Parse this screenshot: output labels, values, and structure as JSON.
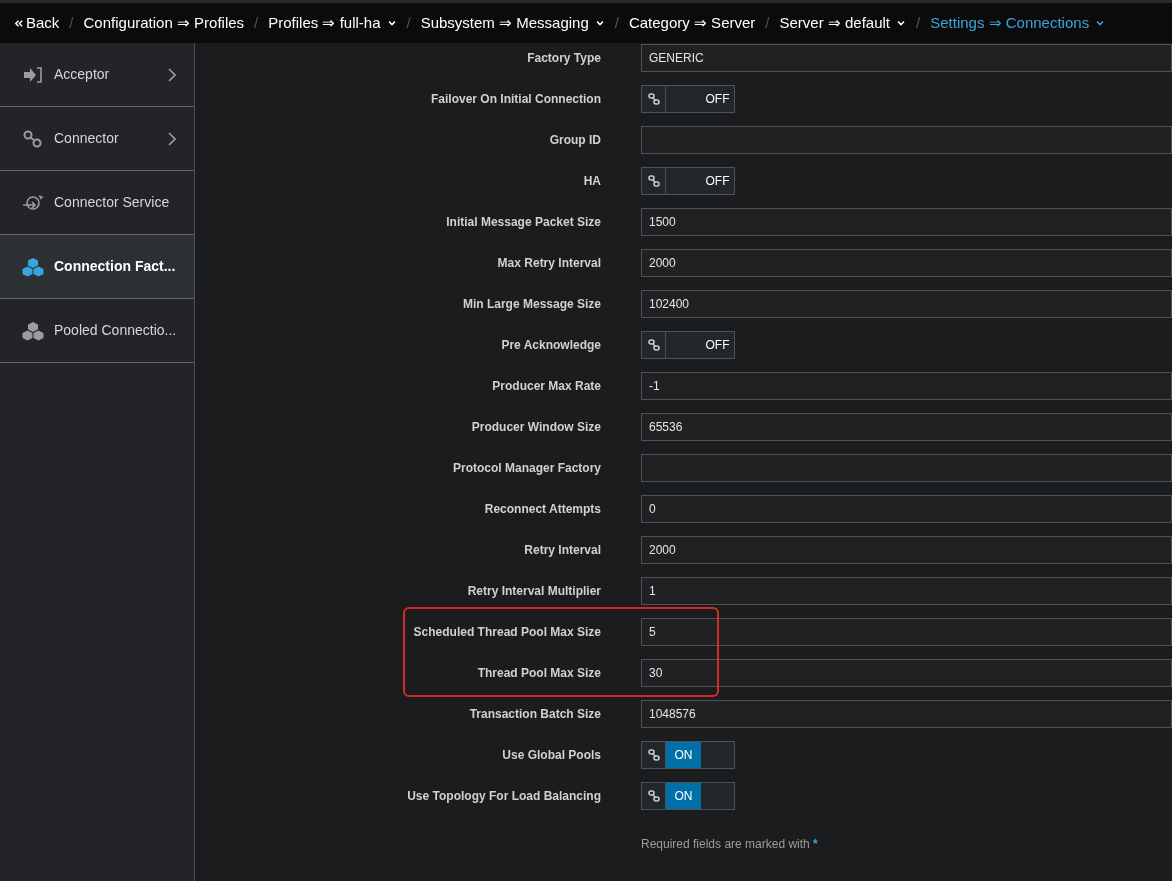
{
  "breadcrumb": {
    "back": "Back",
    "separator": "/",
    "items": [
      {
        "text": "Configuration ⇒ Profiles",
        "dropdown": false,
        "selected": false
      },
      {
        "text": "Profiles ⇒ full-ha",
        "dropdown": true,
        "selected": false
      },
      {
        "text": "Subsystem ⇒ Messaging",
        "dropdown": true,
        "selected": false
      },
      {
        "text": "Category ⇒ Server",
        "dropdown": false,
        "selected": false
      },
      {
        "text": "Server ⇒ default",
        "dropdown": true,
        "selected": false
      },
      {
        "text": "Settings ⇒ Connections",
        "dropdown": true,
        "selected": true
      }
    ]
  },
  "sidebar": {
    "items": [
      {
        "label": "Acceptor",
        "kind": "acceptor",
        "chevron": true,
        "selected": false
      },
      {
        "label": "Connector",
        "kind": "connector",
        "chevron": true,
        "selected": false
      },
      {
        "label": "Connector Service",
        "kind": "service",
        "chevron": false,
        "selected": false
      },
      {
        "label": "Connection Fact...",
        "kind": "cubes",
        "chevron": false,
        "selected": true
      },
      {
        "label": "Pooled Connectio...",
        "kind": "cubes",
        "chevron": false,
        "selected": false
      }
    ]
  },
  "form": {
    "fields": [
      {
        "label": "Factory Type",
        "kind": "text",
        "value": "GENERIC",
        "highlighted": false
      },
      {
        "label": "Failover On Initial Connection",
        "kind": "toggle",
        "on": false,
        "state_text": "OFF",
        "highlighted": false
      },
      {
        "label": "Group ID",
        "kind": "text",
        "highlighted": false
      },
      {
        "label": "HA",
        "kind": "toggle",
        "on": false,
        "state_text": "OFF",
        "highlighted": false
      },
      {
        "label": "Initial Message Packet Size",
        "kind": "text",
        "value": "1500",
        "highlighted": false
      },
      {
        "label": "Max Retry Interval",
        "kind": "text",
        "value": "2000",
        "highlighted": false
      },
      {
        "label": "Min Large Message Size",
        "kind": "text",
        "value": "102400",
        "highlighted": false
      },
      {
        "label": "Pre Acknowledge",
        "kind": "toggle",
        "on": false,
        "state_text": "OFF",
        "highlighted": false
      },
      {
        "label": "Producer Max Rate",
        "kind": "text",
        "value": "-1",
        "highlighted": false
      },
      {
        "label": "Producer Window Size",
        "kind": "text",
        "value": "65536",
        "highlighted": false
      },
      {
        "label": "Protocol Manager Factory",
        "kind": "text",
        "highlighted": false
      },
      {
        "label": "Reconnect Attempts",
        "kind": "text",
        "value": "0",
        "highlighted": false
      },
      {
        "label": "Retry Interval",
        "kind": "text",
        "value": "2000",
        "highlighted": false
      },
      {
        "label": "Retry Interval Multiplier",
        "kind": "text",
        "value": "1",
        "highlighted": false
      },
      {
        "label": "Scheduled Thread Pool Max Size",
        "kind": "text",
        "value": "5",
        "highlighted": true
      },
      {
        "label": "Thread Pool Max Size",
        "kind": "text",
        "value": "30",
        "highlighted": true
      },
      {
        "label": "Transaction Batch Size",
        "kind": "text",
        "value": "1048576",
        "highlighted": false
      },
      {
        "label": "Use Global Pools",
        "kind": "toggle",
        "on": true,
        "state_text": "ON",
        "highlighted": false
      },
      {
        "label": "Use Topology For Load Balancing",
        "kind": "toggle",
        "on": true,
        "state_text": "ON",
        "highlighted": false
      }
    ],
    "footnote": "Required fields are marked with",
    "footnote_mark": "*"
  }
}
